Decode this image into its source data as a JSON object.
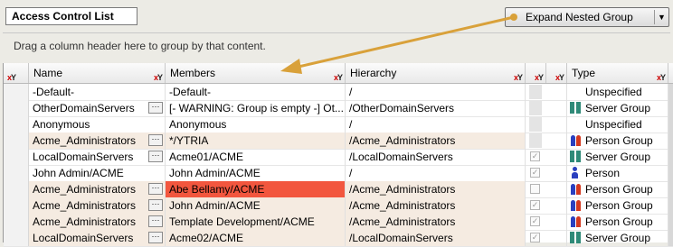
{
  "tab_label": "Access Control List",
  "expand_button": {
    "label": "Expand Nested Group"
  },
  "group_panel_hint": "Drag a column header here to group by that content.",
  "columns": {
    "name": "Name",
    "members": "Members",
    "hierarchy": "Hierarchy",
    "type": "Type"
  },
  "rows": [
    {
      "name": "-Default-",
      "members": "-Default-",
      "hierarchy": "/",
      "type": "Unspecified",
      "icon": "none",
      "checked": null,
      "dots": false,
      "alt": false,
      "highlight": false
    },
    {
      "name": "OtherDomainServers",
      "members": "[- WARNING: Group is empty -] Ot...",
      "hierarchy": "/OtherDomainServers",
      "type": "Server Group",
      "icon": "server-group-icon",
      "checked": null,
      "dots": true,
      "alt": false,
      "highlight": false
    },
    {
      "name": "Anonymous",
      "members": "Anonymous",
      "hierarchy": "/",
      "type": "Unspecified",
      "icon": "none",
      "checked": null,
      "dots": false,
      "alt": false,
      "highlight": false
    },
    {
      "name": "Acme_Administrators",
      "members": "*/YTRIA",
      "hierarchy": "/Acme_Administrators",
      "type": "Person Group",
      "icon": "person-group-icon",
      "checked": null,
      "dots": true,
      "alt": true,
      "highlight": false
    },
    {
      "name": "LocalDomainServers",
      "members": "Acme01/ACME",
      "hierarchy": "/LocalDomainServers",
      "type": "Server Group",
      "icon": "server-group-icon",
      "checked": true,
      "dots": true,
      "alt": false,
      "highlight": false
    },
    {
      "name": "John Admin/ACME",
      "members": "John Admin/ACME",
      "hierarchy": "/",
      "type": "Person",
      "icon": "person-icon",
      "checked": true,
      "dots": false,
      "alt": false,
      "highlight": false
    },
    {
      "name": "Acme_Administrators",
      "members": "Abe Bellamy/ACME",
      "hierarchy": "/Acme_Administrators",
      "type": "Person Group",
      "icon": "person-group-icon",
      "checked": false,
      "dots": true,
      "alt": true,
      "highlight": true
    },
    {
      "name": "Acme_Administrators",
      "members": "John Admin/ACME",
      "hierarchy": "/Acme_Administrators",
      "type": "Person Group",
      "icon": "person-group-icon",
      "checked": true,
      "dots": true,
      "alt": true,
      "highlight": false
    },
    {
      "name": "Acme_Administrators",
      "members": "Template Development/ACME",
      "hierarchy": "/Acme_Administrators",
      "type": "Person Group",
      "icon": "person-group-icon",
      "checked": true,
      "dots": true,
      "alt": true,
      "highlight": false
    },
    {
      "name": "LocalDomainServers",
      "members": "Acme02/ACME",
      "hierarchy": "/LocalDomainServers",
      "type": "Server Group",
      "icon": "server-group-icon",
      "checked": true,
      "dots": true,
      "alt": true,
      "highlight": false
    }
  ],
  "colors": {
    "highlight": "#f2563e",
    "annotation_arrow": "#d9a13a",
    "alt_row": "#f5ebe1"
  }
}
